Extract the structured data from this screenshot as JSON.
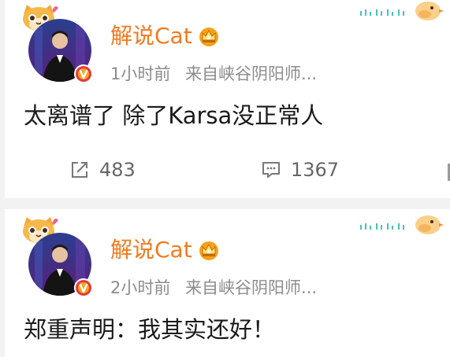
{
  "posts": [
    {
      "user_name": "解说Cat",
      "time": "1小时前",
      "source": "来自峡谷阴阳师...",
      "content": "太离谱了 除了Karsa没正常人",
      "reposts": "483",
      "comments": "1367",
      "icons": {
        "decoration": "cat-sticker-icon",
        "crown": "crown-badge-icon",
        "verified": "verified-v-icon",
        "repost": "repost-icon",
        "comment": "comment-icon",
        "bird": "bird-decoration-icon"
      }
    },
    {
      "user_name": "解说Cat",
      "time": "2小时前",
      "source": "来自峡谷阴阳师...",
      "content": "郑重声明：我其实还好！",
      "icons": {
        "decoration": "cat-sticker-icon",
        "crown": "crown-badge-icon",
        "verified": "verified-v-icon",
        "bird": "bird-decoration-icon"
      }
    }
  ],
  "colors": {
    "name": "#f07b20",
    "meta": "#8c8c8c",
    "content": "#1a1a1a",
    "verified": "#e4393c",
    "background": "#f2f2f2"
  }
}
